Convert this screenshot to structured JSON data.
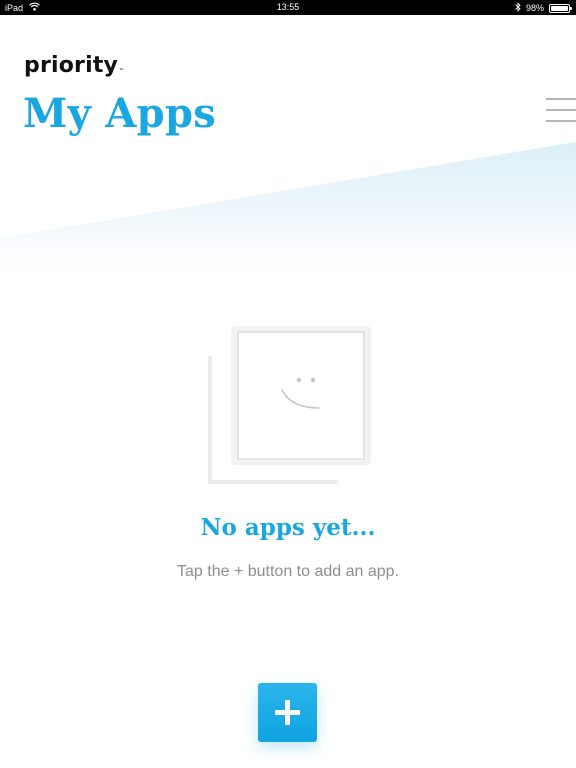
{
  "status_bar": {
    "device": "iPad",
    "time": "13:55",
    "battery": "98%",
    "battery_level": 0.98,
    "icons": [
      "wifi-icon",
      "bluetooth-icon",
      "battery-icon"
    ]
  },
  "header": {
    "logo": "priority",
    "logo_mark": "™",
    "title": "My Apps",
    "menu_icon": "hamburger-menu-icon"
  },
  "empty_state": {
    "illustration": "empty-apps-smiley-icon",
    "title": "No apps yet...",
    "subtitle": "Tap the + button to add an app."
  },
  "fab": {
    "icon": "plus-icon"
  },
  "colors": {
    "accent": "#1aa7e0",
    "muted_text": "#8e8e8e",
    "menu": "#b5b5b5"
  }
}
